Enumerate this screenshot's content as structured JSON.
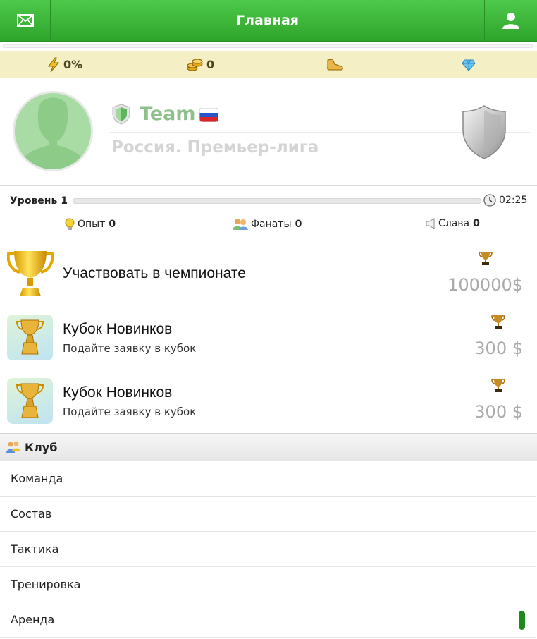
{
  "header": {
    "title": "Главная",
    "left_icon": "mail-icon",
    "right_icon": "profile-icon"
  },
  "resources": {
    "energy": "0%",
    "coins": "0",
    "boots": "",
    "gems": ""
  },
  "team": {
    "name": "Team",
    "flag": "russia",
    "league": "Россия. Премьер-лига"
  },
  "level": {
    "label": "Уровень 1",
    "progress": 0,
    "timer": "02:25"
  },
  "stats": {
    "experience": {
      "label": "Опыт",
      "value": "0"
    },
    "fans": {
      "label": "Фанаты",
      "value": "0"
    },
    "fame": {
      "label": "Слава",
      "value": "0"
    }
  },
  "tournaments": [
    {
      "title": "Участвовать в чемпионате",
      "subtitle": "",
      "prize": "100000$"
    },
    {
      "title": "Кубок Новинков",
      "subtitle": "Подайте заявку в кубок",
      "prize": "300 $"
    },
    {
      "title": "Кубок Новинков",
      "subtitle": "Подайте заявку в кубок",
      "prize": "300 $"
    }
  ],
  "club": {
    "title": "Клуб",
    "items": [
      "Команда",
      "Состав",
      "Тактика",
      "Тренировка",
      "Аренда"
    ]
  },
  "colors": {
    "header_green": "#3bb737",
    "resource_bar": "#f5efc6",
    "team_name": "#8ec08b"
  }
}
